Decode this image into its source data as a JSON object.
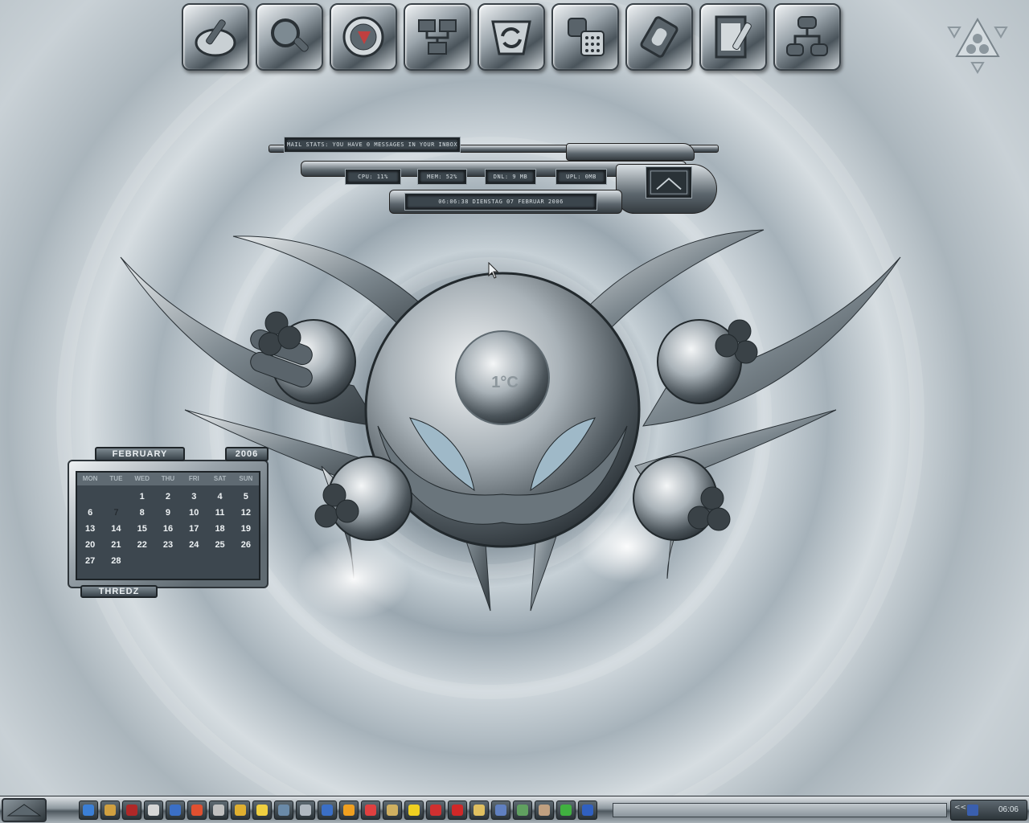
{
  "desktop": {
    "dock_icons": [
      {
        "name": "paint-palette-icon"
      },
      {
        "name": "magnifier-search-icon"
      },
      {
        "name": "globe-network-icon"
      },
      {
        "name": "network-computers-icon"
      },
      {
        "name": "sync-arrows-icon"
      },
      {
        "name": "phone-modem-icon"
      },
      {
        "name": "hardware-chip-icon"
      },
      {
        "name": "document-edit-icon"
      },
      {
        "name": "network-tree-icon"
      }
    ],
    "recycle_icon": "recycle-bin-icon"
  },
  "stats": {
    "mail": "MAIL STATS: YOU HAVE 0 MESSAGES IN YOUR INBOX",
    "cpu": "CPU: 11%",
    "mem": "MEM: 52%",
    "dnl": "DNL: 9 MB",
    "upl": "UPL: 0MB",
    "datetime": "06:06:38    DIENSTAG 07 FEBRUAR 2006"
  },
  "weather": {
    "temp": "1°C"
  },
  "calendar": {
    "month": "FEBRUARY",
    "year": "2006",
    "weekdays": [
      "MON",
      "TUE",
      "WED",
      "THU",
      "FRI",
      "SAT",
      "SUN"
    ],
    "days": [
      "",
      "",
      "1",
      "2",
      "3",
      "4",
      "5",
      "6",
      "7",
      "8",
      "9",
      "10",
      "11",
      "12",
      "13",
      "14",
      "15",
      "16",
      "17",
      "18",
      "19",
      "20",
      "21",
      "22",
      "23",
      "24",
      "25",
      "26",
      "27",
      "28",
      "",
      "",
      "",
      "",
      ""
    ],
    "today": "7",
    "footer": "THREDZ"
  },
  "taskbar": {
    "quick_launch": [
      {
        "name": "ie-icon",
        "color": "#3b7fd6"
      },
      {
        "name": "gear-icon",
        "color": "#d0a040"
      },
      {
        "name": "media-icon",
        "color": "#b02828"
      },
      {
        "name": "cd-icon",
        "color": "#d6d6d6"
      },
      {
        "name": "player-icon",
        "color": "#3b6fc6"
      },
      {
        "name": "paint-icon",
        "color": "#e05030"
      },
      {
        "name": "bucket-icon",
        "color": "#c0c0c0"
      },
      {
        "name": "pencil-icon",
        "color": "#e0b030"
      },
      {
        "name": "banana-icon",
        "color": "#f0d040"
      },
      {
        "name": "network-icon",
        "color": "#6a8aa8"
      },
      {
        "name": "box-icon",
        "color": "#b0b8c0"
      },
      {
        "name": "scissors-icon",
        "color": "#3b6fc6"
      },
      {
        "name": "smiley-icon",
        "color": "#f0a020"
      },
      {
        "name": "face-icon",
        "color": "#e04040"
      },
      {
        "name": "rocket-icon",
        "color": "#d0b060"
      },
      {
        "name": "star-icon",
        "color": "#f0d020"
      },
      {
        "name": "text-icon",
        "color": "#d03030"
      },
      {
        "name": "strawberry-icon",
        "color": "#d02828"
      },
      {
        "name": "hand-icon",
        "color": "#e0c060"
      },
      {
        "name": "grid-icon",
        "color": "#6080c0"
      },
      {
        "name": "display-icon",
        "color": "#60a060"
      },
      {
        "name": "machine-icon",
        "color": "#c0a080"
      },
      {
        "name": "alien-icon",
        "color": "#40b040"
      },
      {
        "name": "book-icon",
        "color": "#3060c0"
      }
    ],
    "tray_arrows": "<<",
    "clock": "06:06"
  }
}
